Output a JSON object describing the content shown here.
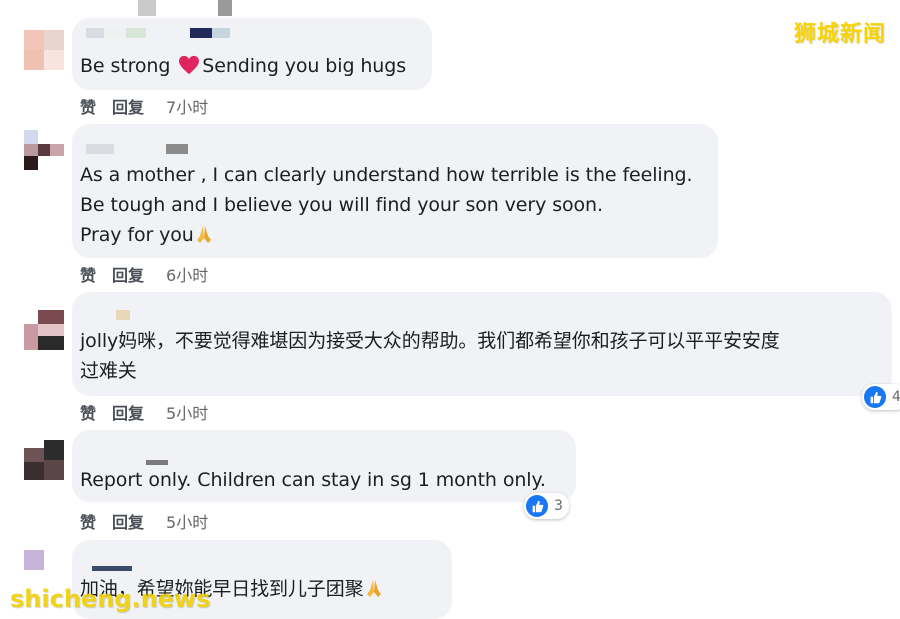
{
  "watermarks": {
    "top": "狮城新闻",
    "bottom": "shicheng.news"
  },
  "actions": {
    "like_label": "赞",
    "reply_label": "回复"
  },
  "icons": {
    "heart": "heart-emoji-icon",
    "pray": "folded-hands-emoji-icon",
    "like": "thumbs-up-icon"
  },
  "colors": {
    "bubble": "#f0f2f5",
    "like_blue": "#1877f2",
    "heart_red": "#e0245e",
    "watermark": "#f7d400"
  },
  "comments": [
    {
      "text_before": "Be strong ",
      "text_after": "Sending you big hugs",
      "time": "7小时"
    },
    {
      "lines": [
        "As a mother , I can clearly understand how terrible is the feeling.",
        "Be tough and I believe you will find your son very soon.",
        "Pray for you"
      ],
      "time": "6小时"
    },
    {
      "lines": [
        "jolly妈咪，不要觉得难堪因为接受大众的帮助。我们都希望你和孩子可以平平安安度",
        "过难关"
      ],
      "time": "5小时",
      "reaction_count": "4"
    },
    {
      "text": "Report only. Children can stay in sg 1 month only.",
      "time": "5小时",
      "reaction_count": "3"
    },
    {
      "text": "加油，希望妳能早日找到儿子团聚"
    }
  ]
}
